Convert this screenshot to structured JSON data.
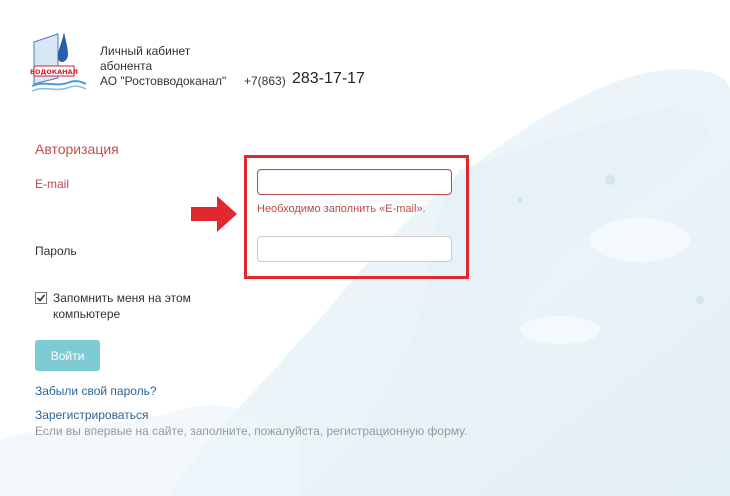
{
  "logo": {
    "wordmark": "ВОДОКАНАЛ"
  },
  "header": {
    "line1": "Личный кабинет",
    "line2": "абонента",
    "line3": "АО \"Ростовводоканал\"",
    "phone_prefix": "+7(863)",
    "phone_number": "283-17-17"
  },
  "form": {
    "title": "Авторизация",
    "email_label": "E-mail",
    "email_value": "",
    "email_error": "Необходимо заполнить «E-mail».",
    "password_label": "Пароль",
    "password_value": "",
    "remember_label": "Запомнить меня на этом компьютере",
    "remember_checked": true,
    "login_button": "Войти",
    "forgot_link": "Забыли свой пароль?",
    "register_link": "Зарегистрироваться",
    "register_hint": "Если вы впервые на сайте, заполните, пожалуйста, регистрационную форму."
  },
  "colors": {
    "error": "#b94a48",
    "highlight": "#e0282e",
    "button": "#7fcbd3",
    "link": "#2a6496"
  },
  "icons": {
    "arrow": "red-right-arrow-icon",
    "check": "checkmark-icon",
    "logo": "vodokanal-logo"
  }
}
